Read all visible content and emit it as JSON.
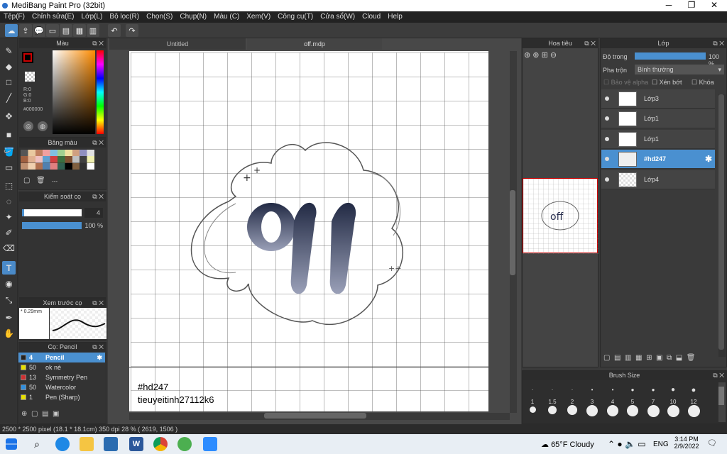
{
  "window": {
    "title": "MediBang Paint Pro (32bit)"
  },
  "menu": [
    "Tệp(F)",
    "Chỉnh sửa(E)",
    "Lớp(L)",
    "Bộ lọc(R)",
    "Chọn(S)",
    "Chụp(N)",
    "Màu (C)",
    "Xem(V)",
    "Công cụ(T)",
    "Cửa sổ(W)",
    "Cloud",
    "Help"
  ],
  "tabs": [
    "Untitled",
    "off.mdp"
  ],
  "color_panel": {
    "title": "Màu",
    "r": "R:0",
    "g": "G:0",
    "b": "B:0",
    "hex": "#000000",
    "primary": "#cc0000"
  },
  "palette_panel": {
    "title": "Bảng màu",
    "more": "---"
  },
  "brush_control": {
    "title": "Kiểm soát cọ",
    "size": "4",
    "opacity": "100 %"
  },
  "preview_panel": {
    "title": "Xem trước cọ",
    "size": "* 0.29mm"
  },
  "brush_list": {
    "title": "Cọ: Pencil",
    "items": [
      {
        "num": "4",
        "name": "Pencil",
        "color": "#222222",
        "selected": true
      },
      {
        "num": "50",
        "name": "ok nè",
        "color": "#e8e000"
      },
      {
        "num": "13",
        "name": "Symmetry Pen",
        "color": "#d03030"
      },
      {
        "num": "50",
        "name": "Watercolor",
        "color": "#3090e0"
      },
      {
        "num": "1",
        "name": "Pen (Sharp)",
        "color": "#e8e000"
      }
    ]
  },
  "navigator": {
    "title": "Hoa tiêu"
  },
  "layer_panel": {
    "title": "Lớp",
    "opacity_label": "Độ trong",
    "opacity_value": "100 %",
    "blend_label": "Pha trộn",
    "blend_value": "Bình thường",
    "protect_alpha": "Bảo vệ alpha",
    "clipping": "Xén bớt",
    "lock": "Khóa",
    "layers": [
      "Lớp3",
      "Lớp1",
      "Lớp1",
      "#hd247",
      "Lớp4"
    ]
  },
  "brush_size": {
    "title": "Brush Size",
    "sizes": [
      "1",
      "1.5",
      "2",
      "3",
      "4",
      "5",
      "7",
      "10",
      "12"
    ]
  },
  "canvas_text": {
    "line1": "#hd247",
    "line2": "tieuyeitinh27112k6"
  },
  "status": "2500 * 2500 pixel   (18.1 * 18.1cm)  350 dpi   28 %   ( 2619, 1506 )",
  "taskbar": {
    "weather": "65°F  Cloudy",
    "lang": "ENG",
    "time": "3:14 PM",
    "date": "2/9/2022"
  }
}
